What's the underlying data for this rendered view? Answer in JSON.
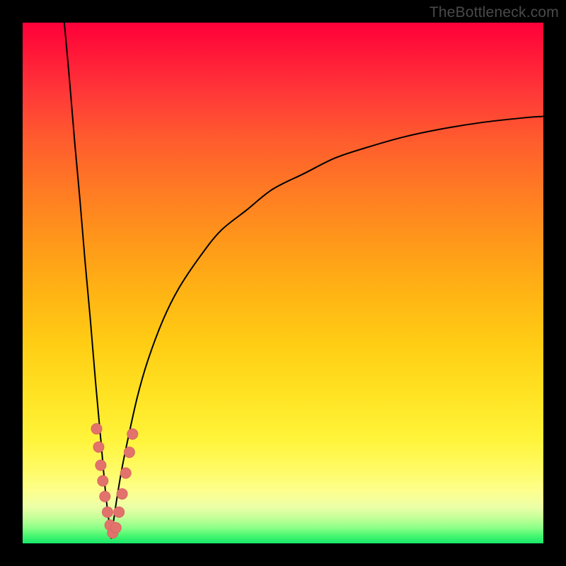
{
  "attribution": "TheBottleneck.com",
  "colors": {
    "curve_stroke": "#000000",
    "marker_fill": "#e2736c",
    "marker_stroke": "#d9655f",
    "gradient_top": "#ff003a",
    "gradient_bottom": "#18e86a"
  },
  "chart_data": {
    "type": "line",
    "title": "",
    "xlabel": "",
    "ylabel": "",
    "xlim": [
      0,
      100
    ],
    "ylim": [
      0,
      100
    ],
    "grid": false,
    "legend": false,
    "notes": "Bottleneck-percent style curve. Y is percent bottleneck (0 at green bottom, 100 at red top). X is an unlabeled parameter sweep. Two curve branches meeting near x≈17, y≈0 forming a V; right branch rises asymptotically toward ~82. Salmon markers cluster near the valley.",
    "series": [
      {
        "name": "left-branch",
        "x": [
          8,
          9,
          10,
          11,
          12,
          13,
          14,
          15,
          16,
          17
        ],
        "values": [
          100,
          89,
          77,
          66,
          54,
          43,
          31,
          20,
          9,
          1
        ]
      },
      {
        "name": "right-branch",
        "x": [
          17,
          18,
          19,
          20,
          22,
          24,
          27,
          30,
          34,
          38,
          43,
          48,
          54,
          60,
          66,
          73,
          80,
          88,
          96,
          100
        ],
        "values": [
          1,
          8,
          14,
          19,
          28,
          35,
          43,
          49,
          55,
          60,
          64,
          68,
          71,
          74,
          76,
          78,
          79.5,
          80.8,
          81.7,
          82
        ]
      }
    ],
    "markers": {
      "name": "highlight-points",
      "x": [
        14.2,
        14.6,
        15.0,
        15.4,
        15.8,
        16.3,
        16.8,
        17.3,
        17.9,
        18.5,
        19.1,
        19.8,
        20.5,
        21.1
      ],
      "values": [
        22,
        18.5,
        15,
        12,
        9,
        6,
        3.5,
        2,
        3,
        6,
        9.5,
        13.5,
        17.5,
        21
      ]
    }
  }
}
